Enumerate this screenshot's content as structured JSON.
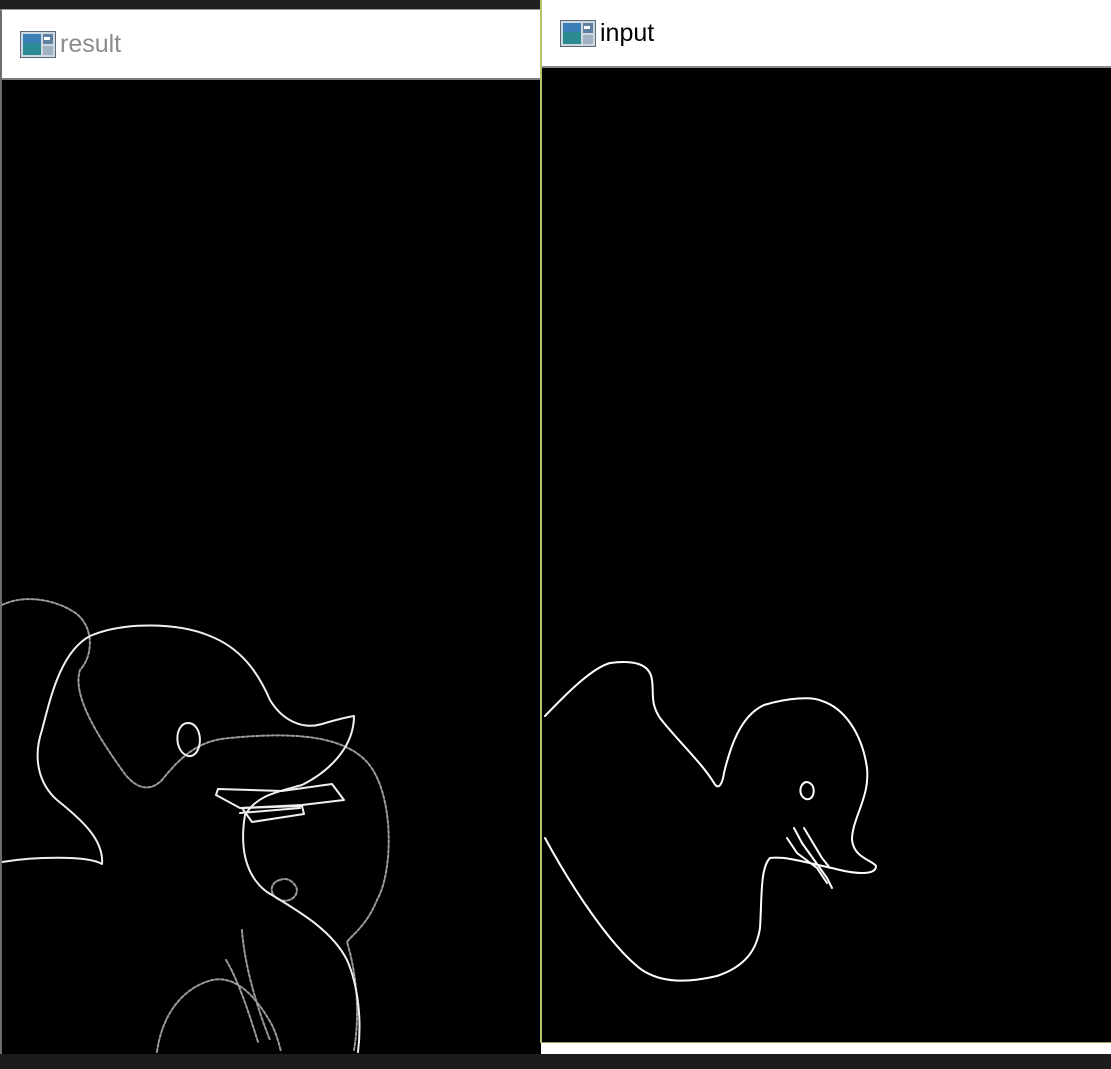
{
  "windows": {
    "result": {
      "title": "result",
      "icon": "opencv-window-icon"
    },
    "input": {
      "title": "input",
      "icon": "opencv-window-icon"
    }
  },
  "colors": {
    "canvas_background": "#000000",
    "edge_primary": "#ffffff",
    "edge_secondary": "#9a9a9a",
    "result_title": "#8c8c8c",
    "input_title": "#000000"
  }
}
